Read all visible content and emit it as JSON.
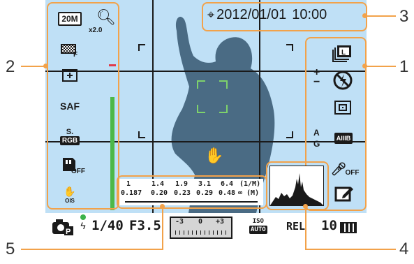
{
  "callouts": {
    "n1": "1",
    "n2": "2",
    "n3": "3",
    "n4": "4",
    "n5": "5"
  },
  "top": {
    "datetime": "2012/01/01",
    "time": "10:00"
  },
  "left_icons": {
    "size": "20M",
    "zoom_label": "x2.0",
    "af": "SAF",
    "colorspace_top": "S.",
    "colorspace_bottom": "RGB",
    "off1": "OFF",
    "ois": "OIS"
  },
  "right_icons": {
    "wb_top": "A",
    "wb_bottom": "G",
    "iso_auto": "AIIIB",
    "mic_off": "OFF"
  },
  "distance_scale": {
    "top_values": [
      "1",
      "1.4",
      "1.9",
      "3.1",
      "6.4",
      "(1/M)"
    ],
    "bottom_values": [
      "0.187",
      "0.20",
      "0.23",
      "0.29",
      "0.48",
      "∞ (M)"
    ]
  },
  "status": {
    "shutter": "1/40",
    "aperture": "F3.5",
    "ev_scale": [
      "-3",
      "0",
      "+3"
    ],
    "iso_top": "ISO",
    "iso_bottom": "AUTO",
    "rel": "REL",
    "shots": "10"
  },
  "colors": {
    "accent": "#f2a24a",
    "screen_bg": "#bfe0f6",
    "af_frame": "#7ed26b",
    "level_bar": "#4db848",
    "silhouette": "#4a6b84"
  },
  "levels": {
    "level_meter": 0.77
  }
}
